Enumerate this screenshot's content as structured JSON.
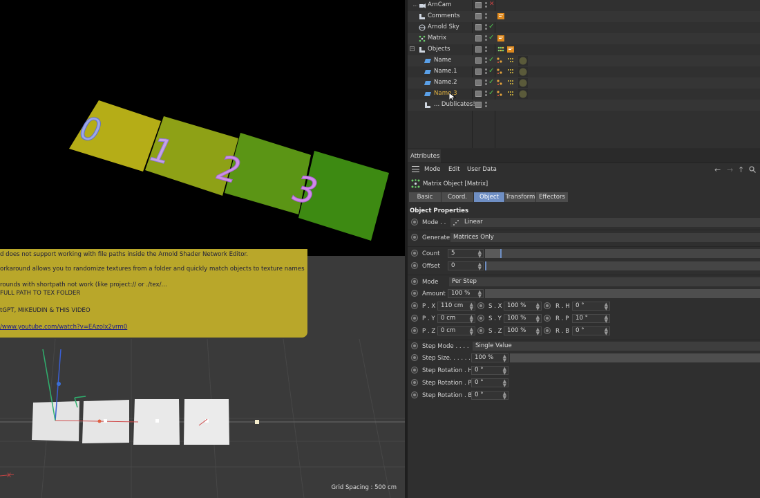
{
  "render_tiles": [
    "0",
    "1",
    "2",
    "3"
  ],
  "note": {
    "lines": [
      "d does not support working with file paths inside the Arnold Shader Network Editor.",
      "orkaround allows you to randomize textures from a folder and quickly match objects to texture names",
      "rounds with shortpath not work (like project:// or ./tex/...",
      "FULL PATH TO TEX FOLDER",
      "tGPT, MIKEUDIN & THIS VIDEO",
      "/www.youtube.com/watch?v=EAzolx2vrm0"
    ]
  },
  "viewport": {
    "grid_spacing": "Grid Spacing : 500 cm",
    "axis_label": "X"
  },
  "object_manager": {
    "rows": [
      {
        "name": "ArnCam"
      },
      {
        "name": "Comments"
      },
      {
        "name": "Arnold Sky"
      },
      {
        "name": "Matrix"
      },
      {
        "name": "Objects"
      },
      {
        "name": "Name"
      },
      {
        "name": "Name.1"
      },
      {
        "name": "Name.2"
      },
      {
        "name": "Name.3"
      },
      {
        "name": "... Dublicates!"
      }
    ]
  },
  "attributes": {
    "panel_title": "Attributes",
    "menu": {
      "mode": "Mode",
      "edit": "Edit",
      "user_data": "User Data"
    },
    "object_title": "Matrix Object [Matrix]",
    "tabs": [
      "Basic",
      "Coord.",
      "Object",
      "Transform",
      "Effectors"
    ],
    "active_tab": "Object",
    "section_title": "Object Properties",
    "mode_label": "Mode . .",
    "mode_value": "Linear",
    "generate_label": "Generate",
    "generate_value": "Matrices Only",
    "count_label": "Count",
    "count_value": "5",
    "offset_label": "Offset",
    "offset_value": "0",
    "mode2_label": "Mode",
    "mode2_value": "Per Step",
    "amount_label": "Amount",
    "amount_value": "100 %",
    "px_label": "P . X",
    "px_value": "110 cm",
    "py_label": "P . Y",
    "py_value": "0 cm",
    "pz_label": "P . Z",
    "pz_value": "0 cm",
    "sx_label": "S . X",
    "sx_value": "100 %",
    "sy_label": "S . Y",
    "sy_value": "100 %",
    "sz_label": "S . Z",
    "sz_value": "100 %",
    "rh_label": "R . H",
    "rh_value": "0 °",
    "rp_label": "R . P",
    "rp_value": "10 °",
    "rb_label": "R . B",
    "rb_value": "0 °",
    "step_mode_label": "Step Mode . . . .",
    "step_mode_value": "Single Value",
    "step_size_label": "Step Size. . . . . .",
    "step_size_value": "100 %",
    "step_rot_h_label": "Step Rotation . H",
    "step_rot_h_value": "0 °",
    "step_rot_p_label": "Step Rotation . P",
    "step_rot_p_value": "0 °",
    "step_rot_b_label": "Step Rotation . B",
    "step_rot_b_value": "0 °"
  },
  "colors": {
    "accent": "#6f8fc4",
    "tile_yellow": "#b8b018",
    "tile_green": "#3d8a12",
    "digit": "#c98ee8",
    "note_bg": "#b9a72a",
    "selected_name": "#e3b442"
  }
}
